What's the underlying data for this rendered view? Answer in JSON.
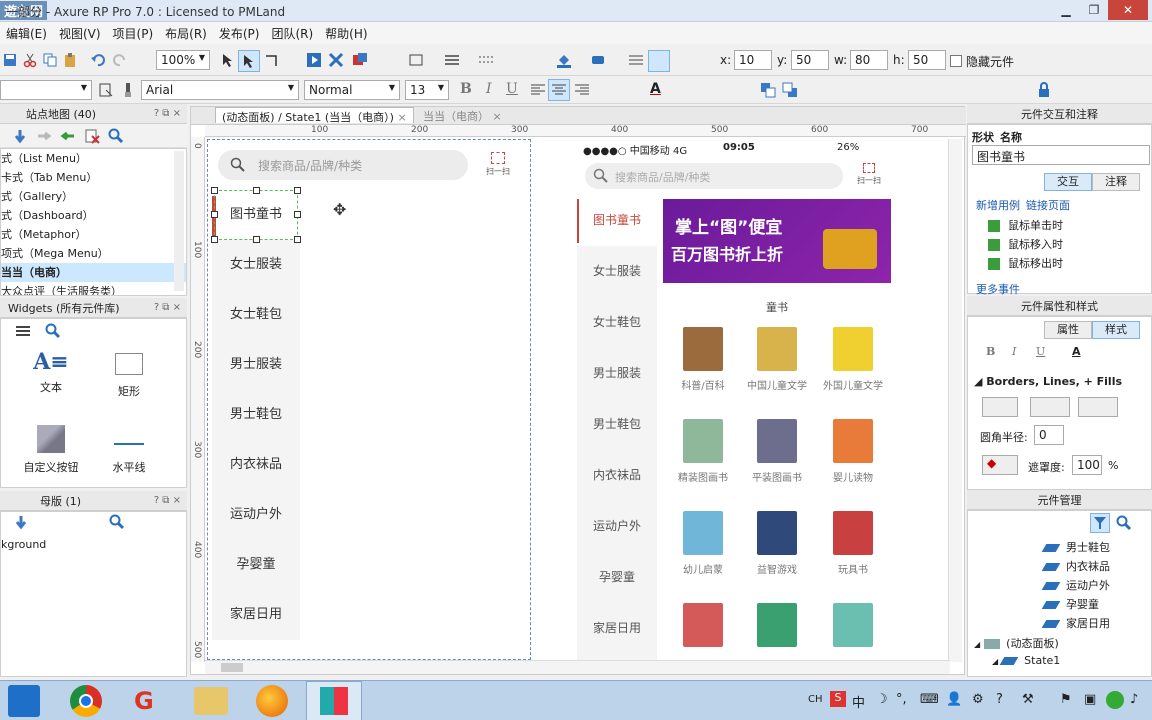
{
  "window": {
    "title": "一部分 - Axure RP Pro 7.0 : Licensed to PMLand",
    "watermark": "遊友网"
  },
  "menu": [
    "编辑(E)",
    "视图(V)",
    "项目(P)",
    "布局(R)",
    "发布(P)",
    "团队(R)",
    "帮助(H)"
  ],
  "toolbar": {
    "zoom": "100%",
    "font": "Arial",
    "style": "Normal",
    "size": "13",
    "x_label": "x:",
    "x": "10",
    "y_label": "y:",
    "y": "50",
    "w_label": "w:",
    "w": "80",
    "h_label": "h:",
    "h": "50",
    "hide_label": "隐藏元件"
  },
  "sitemap": {
    "title": "站点地图 (40)",
    "items": [
      "式（List Menu）",
      "卡式（Tab Menu）",
      "式（Gallery）",
      "式（Dashboard）",
      "式（Metaphor）",
      "项式（Mega Menu）",
      "当当（电商）",
      "大众点评（生活服务类）"
    ],
    "selected_index": 6
  },
  "widgets": {
    "title": "Widgets (所有元件库)",
    "items": [
      "文本",
      "矩形",
      "自定义按钮",
      "水平线"
    ]
  },
  "masters": {
    "title": "母版 (1)",
    "items": [
      "kground"
    ]
  },
  "canvas": {
    "tab_active": "(动态面板) / State1 (当当（电商）)",
    "tab_other": "当当（电商）",
    "ruler_h": [
      "100",
      "200",
      "300",
      "400",
      "500",
      "600",
      "700"
    ],
    "ruler_v": [
      "0",
      "100",
      "200",
      "300",
      "400",
      "500"
    ]
  },
  "design": {
    "search_placeholder": "搜索商品/品牌/种类",
    "scan_label": "扫一扫",
    "categories": [
      "图书童书",
      "女士服装",
      "女士鞋包",
      "男士服装",
      "男士鞋包",
      "内衣袜品",
      "运动户外",
      "孕婴童",
      "家居日用"
    ]
  },
  "phone": {
    "carrier": "●●●●○ 中国移动  4G",
    "time": "09:05",
    "battery": "26%",
    "search_placeholder": "搜索商品/品牌/种类",
    "scan_label": "扫一扫",
    "categories": [
      "图书童书",
      "女士服装",
      "女士鞋包",
      "男士服装",
      "男士鞋包",
      "内衣袜品",
      "运动户外",
      "孕婴童",
      "家居日用"
    ],
    "banner_line1": "掌上“图”便宜",
    "banner_line2": "百万图书折上折",
    "section_title": "童书",
    "books": [
      "科普/百科",
      "中国儿童文学",
      "外国儿童文学",
      "精装图画书",
      "平装图画书",
      "婴儿读物",
      "幼儿启蒙",
      "益智游戏",
      "玩具书",
      "",
      "",
      ""
    ]
  },
  "interaction": {
    "title": "元件交互和注释",
    "shape_label": "形状",
    "name_label": "名称",
    "name_value": "图书童书",
    "tab_interaction": "交互",
    "tab_note": "注释",
    "new_case": "新增用例",
    "link_page": "链接页面",
    "events": [
      "鼠标单击时",
      "鼠标移入时",
      "鼠标移出时"
    ],
    "more": "更多事件"
  },
  "props": {
    "title": "元件属性和样式",
    "tab_props": "属性",
    "tab_style": "样式",
    "section": "Borders, Lines, + Fills",
    "radius_label": "圆角半径:",
    "radius_value": "0",
    "opacity_label": "遮罩度:",
    "opacity_value": "100",
    "opacity_unit": "%"
  },
  "manager": {
    "title": "元件管理",
    "items": [
      "男士鞋包",
      "内衣袜品",
      "运动户外",
      "孕婴童",
      "家居日用"
    ],
    "panel": "(动态面板)",
    "state": "State1"
  },
  "tray": {
    "ime": "CH",
    "zh": "中"
  },
  "colors": {
    "accent": "#c7453a",
    "selection": "#cce8ff",
    "banner": "#7b1fa2"
  }
}
